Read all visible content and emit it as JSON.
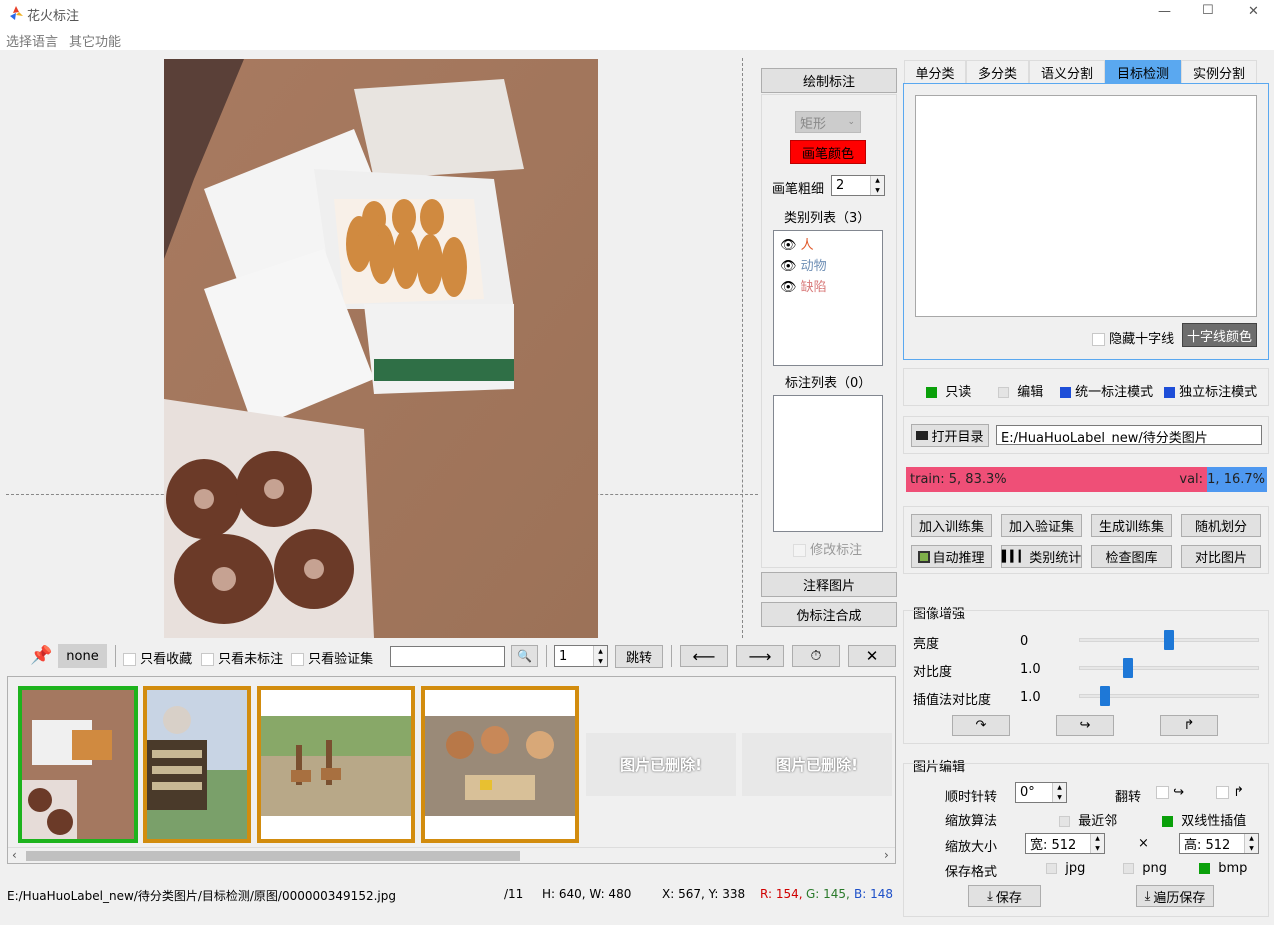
{
  "window": {
    "title": "花火标注",
    "minimize": "—",
    "maximize": "☐",
    "close": "✕"
  },
  "menu": {
    "lang": "选择语言",
    "other": "其它功能"
  },
  "draw": {
    "title": "绘制标注",
    "shape": "矩形",
    "pen_color": "画笔颜色",
    "pen_width_label": "画笔粗细",
    "pen_width": "2",
    "class_list_label": "类别列表（3）",
    "classes": [
      {
        "name": "人",
        "color": "#e05a2c"
      },
      {
        "name": "动物",
        "color": "#6f8fb5"
      },
      {
        "name": "缺陷",
        "color": "#d97b7b"
      }
    ],
    "anno_list_label": "标注列表（0）",
    "modify_label": "修改标注",
    "note_image": "注释图片",
    "pseudo_merge": "伪标注合成"
  },
  "tabs": [
    "单分类",
    "多分类",
    "语义分割",
    "目标检测",
    "实例分割"
  ],
  "crosshair": {
    "hide_label": "隐藏十字线",
    "color_btn": "十字线颜色"
  },
  "modes": {
    "readonly": "只读",
    "edit": "编辑",
    "unified": "统一标注模式",
    "independent": "独立标注模式"
  },
  "dir": {
    "open_btn": "打开目录",
    "path": "E:/HuaHuoLabel_new/待分类图片"
  },
  "split": {
    "train_text": "train: 5, 83.3%",
    "val_text": "val: 1, 16.7%",
    "train_pct": 83.3
  },
  "actions": {
    "add_train": "加入训练集",
    "add_val": "加入验证集",
    "gen_train": "生成训练集",
    "random_split": "随机划分",
    "auto_infer": "自动推理",
    "class_stats": "类别统计",
    "check_gallery": "检查图库",
    "compare": "对比图片"
  },
  "enhance": {
    "title": "图像增强",
    "brightness_label": "亮度",
    "brightness": "0",
    "brightness_pos": 0.5,
    "contrast_label": "对比度",
    "contrast": "1.0",
    "contrast_pos": 0.27,
    "interp_label": "插值法对比度",
    "interp": "1.0",
    "interp_pos": 0.14
  },
  "edit": {
    "title": "图片编辑",
    "rotate_label": "顺时针转",
    "rotate": "0°",
    "flip_label": "翻转",
    "algo_label": "缩放算法",
    "nearest": "最近邻",
    "bilinear": "双线性插值",
    "size_label": "缩放大小",
    "width": "宽: 512",
    "times": "×",
    "height": "高: 512",
    "format_label": "保存格式",
    "jpg": "jpg",
    "png": "png",
    "bmp": "bmp",
    "save": "保存",
    "batch_save": "遍历保存"
  },
  "toolbar": {
    "none": "none",
    "fav": "只看收藏",
    "unlabeled": "只看未标注",
    "val": "只看验证集",
    "search": "",
    "page": "1",
    "jump": "跳转"
  },
  "thumbs": {
    "deleted": "图片已删除!"
  },
  "status": {
    "path": "E:/HuaHuoLabel_new/待分类图片/目标检测/原图/000000349152.jpg",
    "count": "/11",
    "size": "H: 640, W: 480",
    "coord": "X: 567, Y: 338",
    "r": "R: 154,",
    "g": "G: 145,",
    "b": "B: 148",
    "r_color": "#d00000",
    "g_color": "#2a7a2a",
    "b_color": "#1e50c8"
  },
  "colors": {
    "accent": "#5aa8f0",
    "train": "#ef4f77",
    "val": "#4e98f0",
    "green": "#0aa00a",
    "blue": "#1e4ed8",
    "thumb_sel": "#1db31d",
    "thumb_other": "#d28c0e",
    "pen": "#ff0000"
  }
}
